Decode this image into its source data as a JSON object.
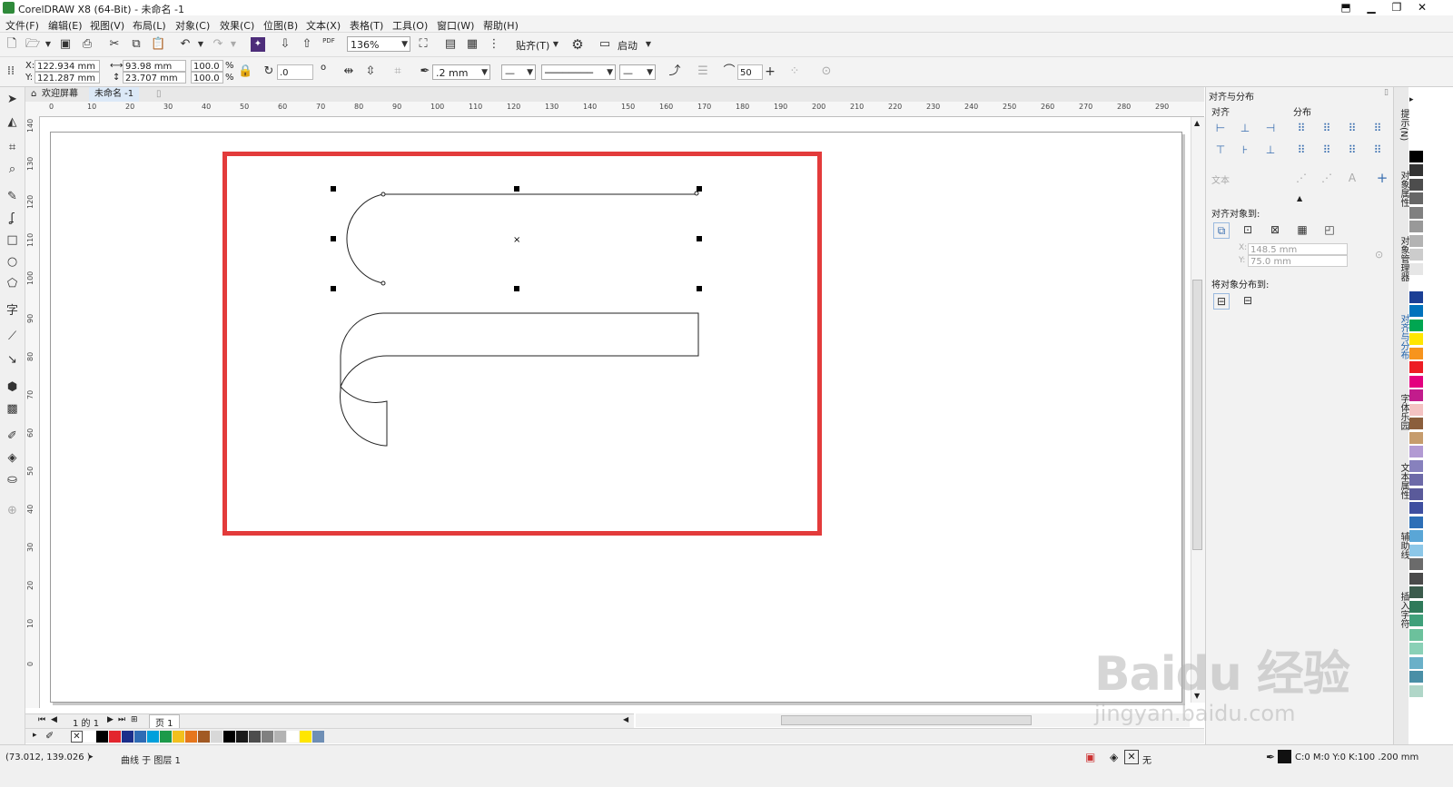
{
  "window": {
    "title": "CorelDRAW X8 (64-Bit) - 未命名 -1",
    "controls": [
      "⬒",
      "▁",
      "❐",
      "✕"
    ]
  },
  "menu": [
    "文件(F)",
    "编辑(E)",
    "视图(V)",
    "布局(L)",
    "对象(C)",
    "效果(C)",
    "位图(B)",
    "文本(X)",
    "表格(T)",
    "工具(O)",
    "窗口(W)",
    "帮助(H)"
  ],
  "toolbar": {
    "zoom": "136%",
    "snap_label": "贴齐(T)",
    "launch_label": "启动",
    "pdf_label": "PDF"
  },
  "properties": {
    "x": "122.934 mm",
    "y": "121.287 mm",
    "width": "93.98 mm",
    "height": "23.707 mm",
    "scale_w": "100.0",
    "scale_h": "100.0",
    "percent": "%",
    "rotation": ".0",
    "degree": "o",
    "outline_width": ".2 mm",
    "smooth": "50",
    "x_label": "X:",
    "y_label": "Y:"
  },
  "doc_tabs": {
    "welcome": "欢迎屏幕",
    "document": "未命名 -1"
  },
  "ruler": {
    "h_ticks": [
      "0",
      "10",
      "20",
      "30",
      "40",
      "50",
      "60",
      "70",
      "80",
      "90",
      "100",
      "110",
      "120",
      "130",
      "140",
      "150",
      "160",
      "170",
      "180",
      "190",
      "200",
      "210",
      "220",
      "230",
      "240",
      "250",
      "260",
      "270",
      "280",
      "290"
    ],
    "v_ticks": [
      "140",
      "130",
      "120",
      "110",
      "100",
      "90",
      "80",
      "70",
      "60",
      "50",
      "40",
      "30",
      "20",
      "10",
      "0"
    ]
  },
  "page_nav": {
    "page_info": "1 的 1",
    "page_tab": "页 1"
  },
  "status": {
    "coords": "(73.012, 139.026 )",
    "object_info": "曲线 于 图层 1",
    "fill_none": "无",
    "outline_info": "C:0 M:0 Y:0 K:100  .200 mm"
  },
  "docker": {
    "title": "对齐与分布",
    "align_label": "对齐",
    "distribute_label": "分布",
    "text_label": "文本",
    "align_to_label": "对齐对象到:",
    "x_value": "148.5 mm",
    "y_value": "75.0 mm",
    "x_lbl": "X:",
    "y_lbl": "Y:",
    "distribute_to_label": "将对象分布到:"
  },
  "side_tabs": [
    "提示(N)",
    "对象属性",
    "对象管理器",
    "对齐与分布",
    "字体乐园",
    "文本属性",
    "辅助线",
    "插入字符"
  ],
  "palette_colors": [
    "#ffffff",
    "#000000",
    "#e3262e",
    "#1b2e8b",
    "#2e6bb5",
    "#00a0dc",
    "#1c9a4a",
    "#f2c01d",
    "#e6761c",
    "#a25a24",
    "#d8d8d8",
    "#000000",
    "#1a1a1a",
    "#4d4d4d",
    "#808080",
    "#b3b3b3",
    "#ffffff",
    "#ffe600",
    "#6f8fb5"
  ],
  "side_palette_colors": [
    "#ffffff",
    "#000000",
    "#333333",
    "#4d4d4d",
    "#666666",
    "#808080",
    "#999999",
    "#b3b3b3",
    "#cccccc",
    "#e6e6e6",
    "#ffffff",
    "#1b3f95",
    "#0072bc",
    "#00a651",
    "#ffe600",
    "#f7941d",
    "#ed1c24",
    "#e4007f",
    "#c21c8c",
    "#f4c2c2",
    "#8b5e3c",
    "#c69c6d",
    "#b29ad3",
    "#8781bd",
    "#6d6aa8",
    "#5a5a9a",
    "#3f4fa0",
    "#2d6fb7",
    "#5aa6d6",
    "#8cc7e8",
    "#6b6b6b",
    "#4a4a4a",
    "#3b5b4c",
    "#2f7a5a",
    "#3fa07a",
    "#6cc19c",
    "#8ad0b6",
    "#6ab0c8",
    "#4a8fa6",
    "#b0d6c8"
  ],
  "watermark": "Baidu 经验",
  "watermark_url": "jingyan.baidu.com"
}
